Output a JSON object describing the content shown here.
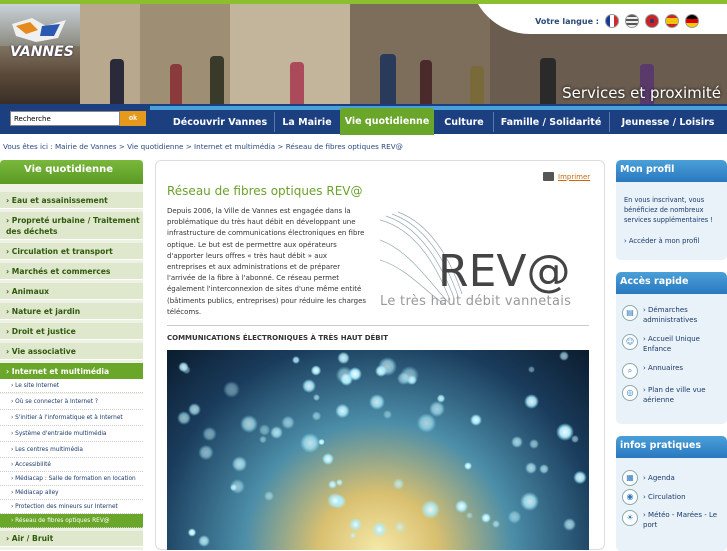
{
  "header": {
    "logo_text": "VANNES",
    "lang_label": "Votre langue :",
    "languages": [
      "fr",
      "en-us",
      "en-gb",
      "es",
      "de"
    ],
    "tagline": "Services et proximité"
  },
  "search": {
    "placeholder": "Recherche",
    "button": "ok"
  },
  "nav": {
    "tabs": [
      "Découvrir Vannes",
      "La Mairie",
      "Vie quotidienne",
      "Culture",
      "Famille / Solidarité",
      "Jeunesse / Loisirs"
    ],
    "active": "Vie quotidienne"
  },
  "breadcrumb": "Vous êtes ici : Mairie de Vannes > Vie quotidienne > Internet et multimédia > Réseau de fibres optiques REV@",
  "leftnav": {
    "title": "Vie quotidienne",
    "items": [
      "› Eau et assainissement",
      "› Propreté urbaine / Traitement des déchets",
      "› Circulation et transport",
      "› Marchés et commerces",
      "› Animaux",
      "› Nature et jardin",
      "› Droit et justice",
      "› Vie associative",
      "› Internet et multimédia"
    ],
    "subitems": [
      "› Le site Internet",
      "› Où se connecter à Internet ?",
      "› S'initier à l'informatique et à Internet",
      "› Système d'entraide multimédia",
      "› Les centres multimédia",
      "› Accessibilité",
      "› Médiacap : Salle de formation en location",
      "› Médiacap alley",
      "› Protection des mineurs sur Internet",
      "› Réseau de fibres optiques REV@"
    ],
    "after": "› Air / Bruit"
  },
  "main": {
    "print": "Imprimer",
    "title": "Réseau de fibres optiques REV@",
    "intro": "Depuis 2006, la Ville de Vannes est engagée dans la problématique du très haut débit en développant une infrastructure de communications électroniques en fibre optique. Le but est de permettre aux opérateurs d'apporter leurs offres « très haut débit » aux entreprises et aux administrations et de préparer l'arrivée de la fibre à l'abonné. Ce réseau permet également l'interconnexion de sites d'une même entité (bâtiments publics, entreprises) pour réduire les charges télécoms.",
    "rev_text": "REV@",
    "rev_tagline": "Le très haut débit vannetais",
    "section_title": "COMMUNICATIONS ÉLECTRONIQUES À TRÈS HAUT DÉBIT"
  },
  "right": {
    "profile_title": "Mon profil",
    "profile_text": "En vous inscrivant, vous bénéficiez de nombreux services supplémentaires !",
    "profile_link": "›  Accéder à mon profil",
    "quick_title": "Accès rapide",
    "quick": [
      "› Démarches administratives",
      "› Accueil Unique Enfance",
      "› Annuaires",
      "› Plan de ville vue aérienne"
    ],
    "info_title": "infos pratiques",
    "info": [
      "› Agenda",
      "› Circulation",
      "› Météo - Marées - Le port"
    ]
  },
  "colors": {
    "green": "#6aa62a",
    "navy": "#1c3f80",
    "blue": "#2a78c0",
    "orange": "#e59a1c"
  }
}
